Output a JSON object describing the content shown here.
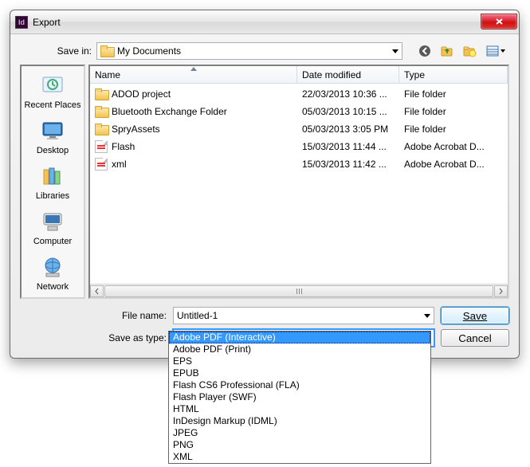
{
  "window": {
    "title": "Export"
  },
  "toolbar": {
    "save_in_label": "Save in:",
    "folder_icon": "folder-icon",
    "current_folder": "My Documents",
    "nav": {
      "back": "back-icon",
      "up": "up-icon",
      "newfolder": "new-folder-icon",
      "views": "views-icon"
    }
  },
  "places": [
    {
      "label": "Recent Places",
      "icon": "recent-places-icon"
    },
    {
      "label": "Desktop",
      "icon": "desktop-icon"
    },
    {
      "label": "Libraries",
      "icon": "libraries-icon"
    },
    {
      "label": "Computer",
      "icon": "computer-icon"
    },
    {
      "label": "Network",
      "icon": "network-icon"
    }
  ],
  "columns": {
    "name": "Name",
    "date": "Date modified",
    "type": "Type"
  },
  "files": [
    {
      "name": "ADOD project",
      "date": "22/03/2013 10:36 ...",
      "type": "File folder",
      "kind": "folder"
    },
    {
      "name": "Bluetooth Exchange Folder",
      "date": "05/03/2013 10:15 ...",
      "type": "File folder",
      "kind": "folder"
    },
    {
      "name": "SpryAssets",
      "date": "05/03/2013 3:05 PM",
      "type": "File folder",
      "kind": "folder"
    },
    {
      "name": "Flash",
      "date": "15/03/2013 11:44 ...",
      "type": "Adobe Acrobat D...",
      "kind": "pdf"
    },
    {
      "name": "xml",
      "date": "15/03/2013 11:42 ...",
      "type": "Adobe Acrobat D...",
      "kind": "pdf"
    }
  ],
  "fields": {
    "filename_label": "File name:",
    "filename_value": "Untitled-1",
    "type_label": "Save as type:",
    "type_value": "Adobe PDF (Interactive)"
  },
  "buttons": {
    "save": "Save",
    "cancel": "Cancel"
  },
  "type_options": [
    "Adobe PDF (Interactive)",
    "Adobe PDF (Print)",
    "EPS",
    "EPUB",
    "Flash CS6 Professional (FLA)",
    "Flash Player (SWF)",
    "HTML",
    "InDesign Markup (IDML)",
    "JPEG",
    "PNG",
    "XML"
  ],
  "type_selected_index": 0
}
